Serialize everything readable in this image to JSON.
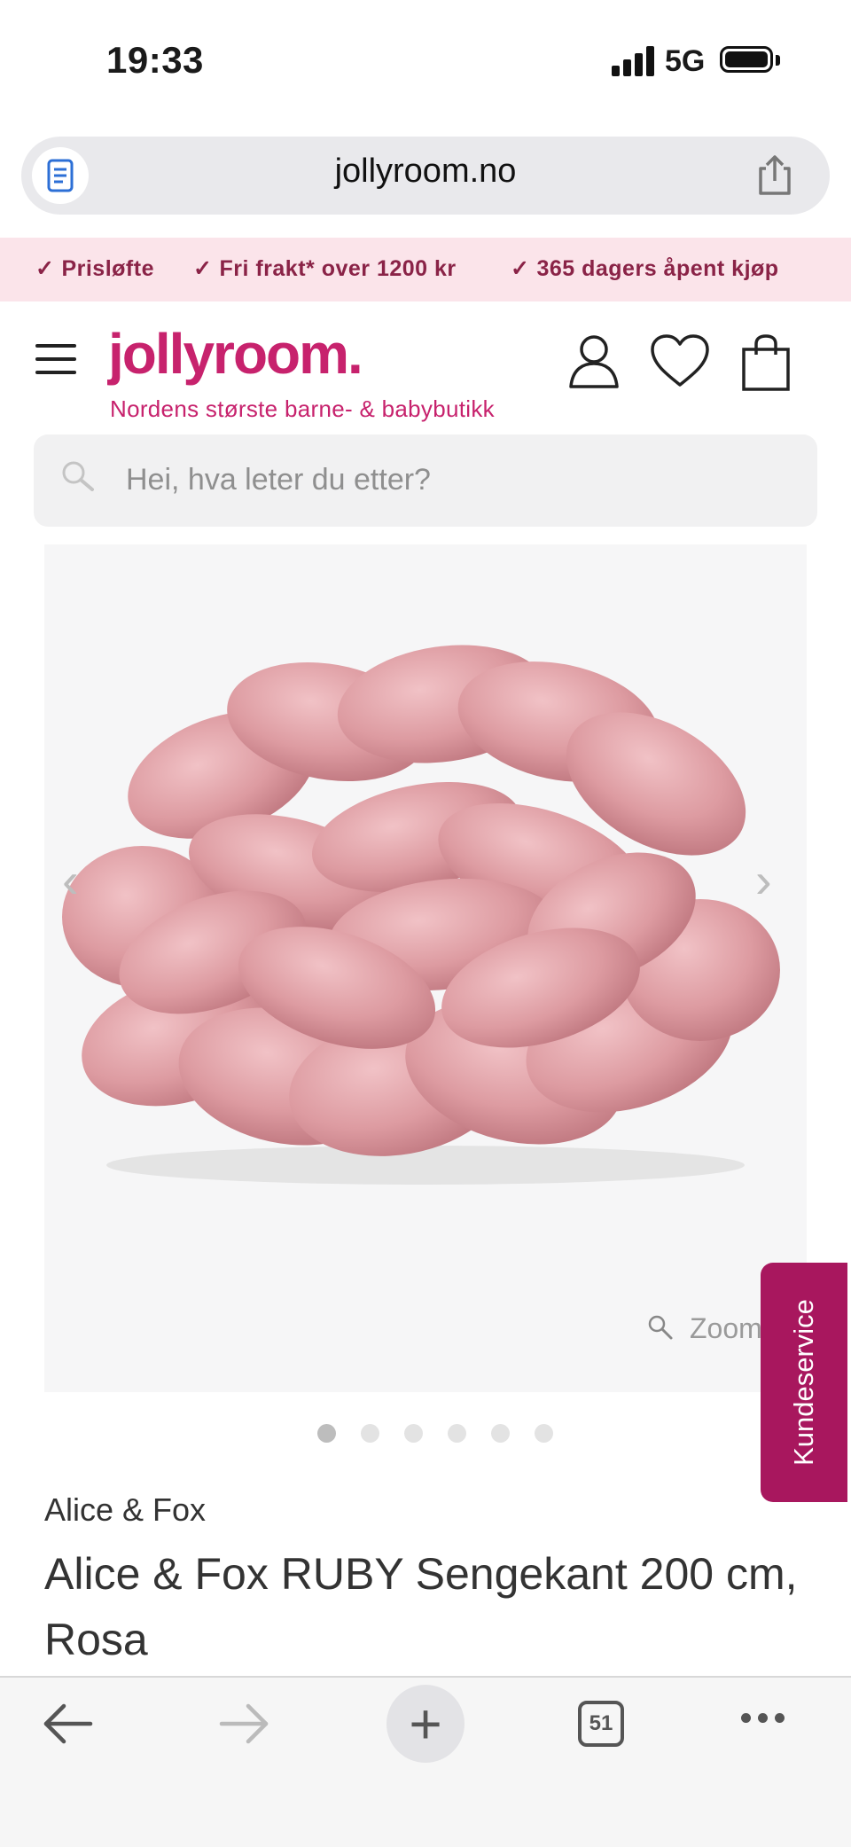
{
  "status_bar": {
    "time": "19:33",
    "network": "5G"
  },
  "browser": {
    "url": "jollyroom.no",
    "tab_count": "51"
  },
  "promo": {
    "items": [
      "Prisløfte",
      "Fri frakt* over 1200 kr",
      "365 dagers åpent kjøp"
    ],
    "color": "#8a2347",
    "background": "#fbe4ea"
  },
  "header": {
    "logo": "jollyroom.",
    "tagline": "Nordens største barne- & babybutikk",
    "brand_color": "#c7226d"
  },
  "search": {
    "placeholder": "Hei, hva leter du etter?"
  },
  "gallery": {
    "zoom_label": "Zoom",
    "image_count": 6,
    "active_index": 0
  },
  "side_tab": {
    "label": "Kundeservice",
    "color": "#a8175e"
  },
  "product": {
    "brand": "Alice & Fox",
    "name": "Alice & Fox RUBY Sengekant 200 cm, Rosa"
  }
}
